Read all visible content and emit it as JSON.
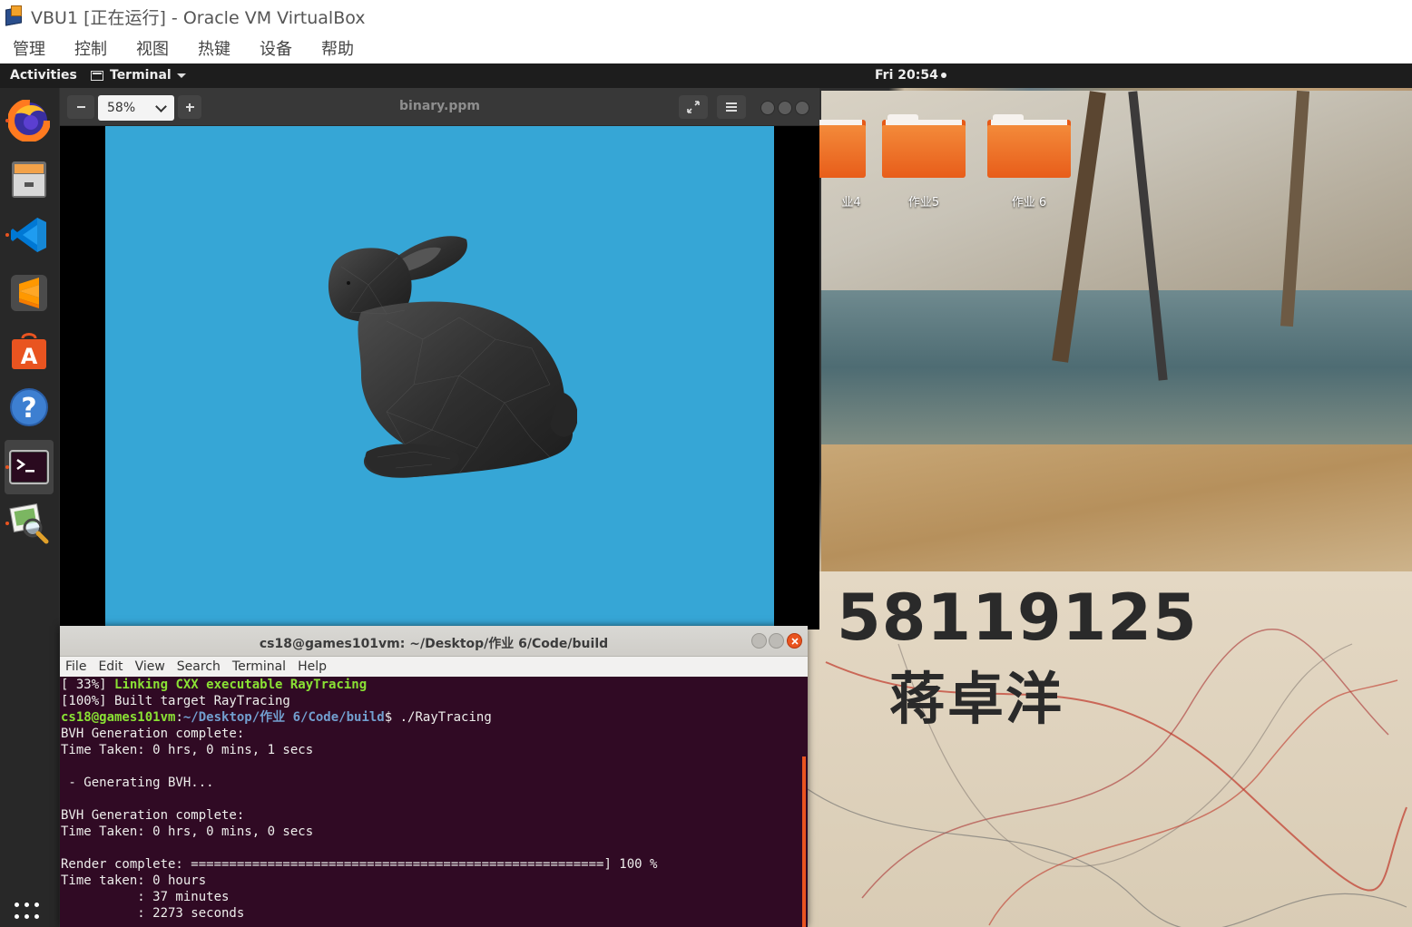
{
  "host": {
    "title": "VBU1 [正在运行] - Oracle VM VirtualBox",
    "menus": [
      "管理",
      "控制",
      "视图",
      "热键",
      "设备",
      "帮助"
    ]
  },
  "topbar": {
    "activities": "Activities",
    "app_menu": "Terminal",
    "clock": "Fri 20:54"
  },
  "dock": {
    "items": [
      {
        "name": "firefox-icon",
        "running": true
      },
      {
        "name": "files-icon",
        "running": false
      },
      {
        "name": "vscode-icon",
        "running": true
      },
      {
        "name": "sublime-text-icon",
        "running": false
      },
      {
        "name": "software-center-icon",
        "running": false
      },
      {
        "name": "help-icon",
        "running": false
      },
      {
        "name": "terminal-icon",
        "running": true,
        "active": true
      },
      {
        "name": "image-viewer-icon",
        "running": true
      }
    ]
  },
  "desktop": {
    "folders": [
      "业4",
      "作业5",
      "作业 6"
    ],
    "wallpaper_number": "58119125",
    "wallpaper_name": "蒋卓洋"
  },
  "viewer": {
    "zoom": "58%",
    "title": "binary.ppm"
  },
  "terminal": {
    "title": "cs18@games101vm: ~/Desktop/作业 6/Code/build",
    "menus": [
      "File",
      "Edit",
      "View",
      "Search",
      "Terminal",
      "Help"
    ],
    "lines": {
      "l1_prefix": "[ 33%] ",
      "l1_green": "Linking CXX executable RayTracing",
      "l2": "[100%] Built target RayTracing",
      "l3_user": "cs18@games101vm",
      "l3_colon": ":",
      "l3_path": "~/Desktop/作业 6/Code/build",
      "l3_cmd": "$ ./RayTracing",
      "l4": "BVH Generation complete:",
      "l5": "Time Taken: 0 hrs, 0 mins, 1 secs",
      "l6": "",
      "l7": " - Generating BVH...",
      "l8": "",
      "l9": "BVH Generation complete:",
      "l10": "Time Taken: 0 hrs, 0 mins, 0 secs",
      "l11": "",
      "l12": "Render complete: ======================================================] 100 %",
      "l13": "Time taken: 0 hours",
      "l14": "          : 37 minutes",
      "l15": "          : 2273 seconds"
    }
  }
}
